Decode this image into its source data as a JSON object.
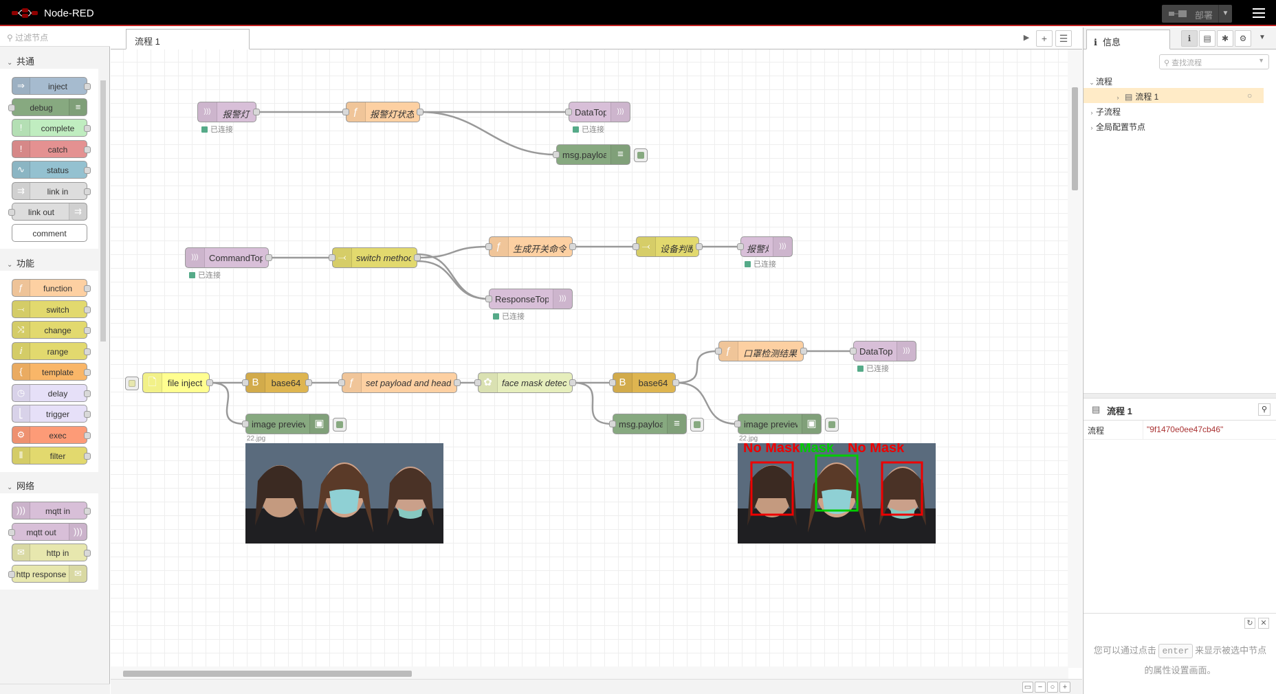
{
  "header": {
    "app_name": "Node-RED",
    "deploy_label": "部署"
  },
  "palette": {
    "filter_placeholder": "过滤节点",
    "categories": [
      {
        "name": "共通",
        "nodes": [
          {
            "label": "inject",
            "color": "#a6bbcf",
            "icon": "arrow-right-icon",
            "dir": "in"
          },
          {
            "label": "debug",
            "color": "#87a980",
            "icon": "list-icon",
            "dir": "out"
          },
          {
            "label": "complete",
            "color": "#c0edc0",
            "icon": "exclamation-icon",
            "dir": "in"
          },
          {
            "label": "catch",
            "color": "#e49191",
            "icon": "exclamation-icon",
            "dir": "in"
          },
          {
            "label": "status",
            "color": "#94c1d0",
            "icon": "pulse-icon",
            "dir": "in"
          },
          {
            "label": "link in",
            "color": "#dddddd",
            "icon": "link-icon",
            "dir": "in"
          },
          {
            "label": "link out",
            "color": "#dddddd",
            "icon": "link-icon",
            "dir": "out"
          },
          {
            "label": "comment",
            "color": "#ffffff",
            "icon": "comment-icon",
            "dir": "none"
          }
        ]
      },
      {
        "name": "功能",
        "nodes": [
          {
            "label": "function",
            "color": "#fdd0a2",
            "icon": "function-icon",
            "dir": "in"
          },
          {
            "label": "switch",
            "color": "#e2d96e",
            "icon": "switch-icon",
            "dir": "in"
          },
          {
            "label": "change",
            "color": "#e2d96e",
            "icon": "change-icon",
            "dir": "in"
          },
          {
            "label": "range",
            "color": "#e2d96e",
            "icon": "range-icon",
            "dir": "in"
          },
          {
            "label": "template",
            "color": "#f9b668",
            "icon": "template-icon",
            "dir": "in"
          },
          {
            "label": "delay",
            "color": "#e6e0f8",
            "icon": "timer-icon",
            "dir": "in"
          },
          {
            "label": "trigger",
            "color": "#e6e0f8",
            "icon": "trigger-icon",
            "dir": "in"
          },
          {
            "label": "exec",
            "color": "#fd9b77",
            "icon": "gear-icon",
            "dir": "in"
          },
          {
            "label": "filter",
            "color": "#e2d96e",
            "icon": "filter-icon",
            "dir": "in"
          }
        ]
      },
      {
        "name": "网络",
        "nodes": [
          {
            "label": "mqtt in",
            "color": "#d8bfd8",
            "icon": "bridge-icon",
            "dir": "in"
          },
          {
            "label": "mqtt out",
            "color": "#d8bfd8",
            "icon": "bridge-icon",
            "dir": "out"
          },
          {
            "label": "http in",
            "color": "#e7e7ae",
            "icon": "globe-icon",
            "dir": "in"
          },
          {
            "label": "http response",
            "color": "#e7e7ae",
            "icon": "globe-icon",
            "dir": "out"
          }
        ]
      }
    ]
  },
  "workspace": {
    "tabs": [
      {
        "label": "流程 1"
      }
    ],
    "nodes": [
      {
        "id": "n1",
        "label": "报警灯",
        "color": "#d8bfd8",
        "icon": "bridge-icon",
        "icon_side": "left",
        "italic": true,
        "in": false,
        "out": true,
        "status": "已连接"
      },
      {
        "id": "n2",
        "label": "报警灯状态",
        "color": "#fdd0a2",
        "icon": "function-icon",
        "icon_side": "left",
        "italic": true,
        "in": true,
        "out": true
      },
      {
        "id": "n3",
        "label": "DataTopic",
        "color": "#d8bfd8",
        "icon": "bridge-icon",
        "icon_side": "right",
        "italic": false,
        "in": true,
        "out": false,
        "status": "已连接"
      },
      {
        "id": "n4",
        "label": "msg.payload",
        "color": "#87a980",
        "icon": "list-icon",
        "icon_side": "right",
        "italic": false,
        "in": true,
        "out": false,
        "debug": true
      },
      {
        "id": "n5",
        "label": "CommandTopic",
        "color": "#d8bfd8",
        "icon": "bridge-icon",
        "icon_side": "left",
        "italic": false,
        "in": false,
        "out": true,
        "status": "已连接"
      },
      {
        "id": "n6",
        "label": "switch method",
        "color": "#e2d96e",
        "icon": "switch-icon",
        "icon_side": "left",
        "italic": true,
        "in": true,
        "out": true
      },
      {
        "id": "n7",
        "label": "生成开关命令",
        "color": "#fdd0a2",
        "icon": "function-icon",
        "icon_side": "left",
        "italic": true,
        "in": true,
        "out": true
      },
      {
        "id": "n8",
        "label": "设备判断",
        "color": "#e2d96e",
        "icon": "switch-icon",
        "icon_side": "left",
        "italic": true,
        "in": true,
        "out": true
      },
      {
        "id": "n9",
        "label": "报警灯",
        "color": "#d8bfd8",
        "icon": "bridge-icon",
        "icon_side": "right",
        "italic": true,
        "in": true,
        "out": false,
        "status": "已连接"
      },
      {
        "id": "n10",
        "label": "ResponseTopic",
        "color": "#d8bfd8",
        "icon": "bridge-icon",
        "icon_side": "right",
        "italic": false,
        "in": true,
        "out": false,
        "status": "已连接"
      },
      {
        "id": "n11",
        "label": "file inject",
        "color": "#fffe90",
        "icon": "file-icon",
        "icon_side": "left",
        "italic": false,
        "in": false,
        "out": true,
        "inject": true
      },
      {
        "id": "n12",
        "label": "base64",
        "color": "#deb550",
        "icon": "base64-icon",
        "icon_side": "left",
        "italic": false,
        "in": true,
        "out": true
      },
      {
        "id": "n13",
        "label": "set payload and headers",
        "color": "#fdd0a2",
        "icon": "function-icon",
        "icon_side": "left",
        "italic": true,
        "in": true,
        "out": true
      },
      {
        "id": "n14",
        "label": "face mask detect",
        "color": "#e6eebc",
        "icon": "ai-icon",
        "icon_side": "left",
        "italic": true,
        "in": true,
        "out": true
      },
      {
        "id": "n15",
        "label": "base64",
        "color": "#deb550",
        "icon": "base64-icon",
        "icon_side": "left",
        "italic": false,
        "in": true,
        "out": true
      },
      {
        "id": "n16",
        "label": "口罩检测结果",
        "color": "#fdd0a2",
        "icon": "function-icon",
        "icon_side": "left",
        "italic": true,
        "in": true,
        "out": true
      },
      {
        "id": "n17",
        "label": "DataTopic",
        "color": "#d8bfd8",
        "icon": "bridge-icon",
        "icon_side": "right",
        "italic": false,
        "in": true,
        "out": false,
        "status": "已连接"
      },
      {
        "id": "n18",
        "label": "image preview",
        "color": "#87a980",
        "icon": "image-icon",
        "icon_side": "right",
        "italic": false,
        "in": true,
        "out": false,
        "debug": true,
        "image_label": "22.jpg"
      },
      {
        "id": "n19",
        "label": "msg.payload",
        "color": "#87a980",
        "icon": "list-icon",
        "icon_side": "right",
        "italic": false,
        "in": true,
        "out": false,
        "debug": true
      },
      {
        "id": "n20",
        "label": "image preview",
        "color": "#87a980",
        "icon": "image-icon",
        "icon_side": "right",
        "italic": false,
        "in": true,
        "out": false,
        "debug": true,
        "image_label": "22.jpg"
      }
    ],
    "wires": [
      [
        "n1",
        "n2"
      ],
      [
        "n2",
        "n3"
      ],
      [
        "n2",
        "n4"
      ],
      [
        "n5",
        "n6"
      ],
      [
        "n6",
        "n7"
      ],
      [
        "n6",
        "n10"
      ],
      [
        "n6",
        "n10"
      ],
      [
        "n7",
        "n8"
      ],
      [
        "n8",
        "n9"
      ],
      [
        "n11",
        "n12"
      ],
      [
        "n11",
        "n18"
      ],
      [
        "n12",
        "n13"
      ],
      [
        "n13",
        "n14"
      ],
      [
        "n14",
        "n15"
      ],
      [
        "n14",
        "n19"
      ],
      [
        "n15",
        "n16"
      ],
      [
        "n15",
        "n20"
      ],
      [
        "n16",
        "n17"
      ]
    ],
    "detection_labels": [
      "Mask",
      "No Mask"
    ]
  },
  "sidebar": {
    "tab_label": "信息",
    "search_placeholder": "查找流程",
    "tree": [
      {
        "label": "流程",
        "expanded": true
      },
      {
        "label": "流程 1",
        "selected": true
      },
      {
        "label": "子流程",
        "expanded": false
      },
      {
        "label": "全局配置节点",
        "expanded": false
      }
    ],
    "selection_title": "流程 1",
    "property_key": "流程",
    "property_value": "\"9f1470e0ee47cb46\"",
    "help_before": "您可以通过点击",
    "help_key": "enter",
    "help_after": "来显示被选中节点的属性设置画面。"
  },
  "colors": {
    "header_bg": "#000000",
    "accent": "#c02020",
    "wire": "#999999",
    "status_connected": "#55aa88"
  }
}
